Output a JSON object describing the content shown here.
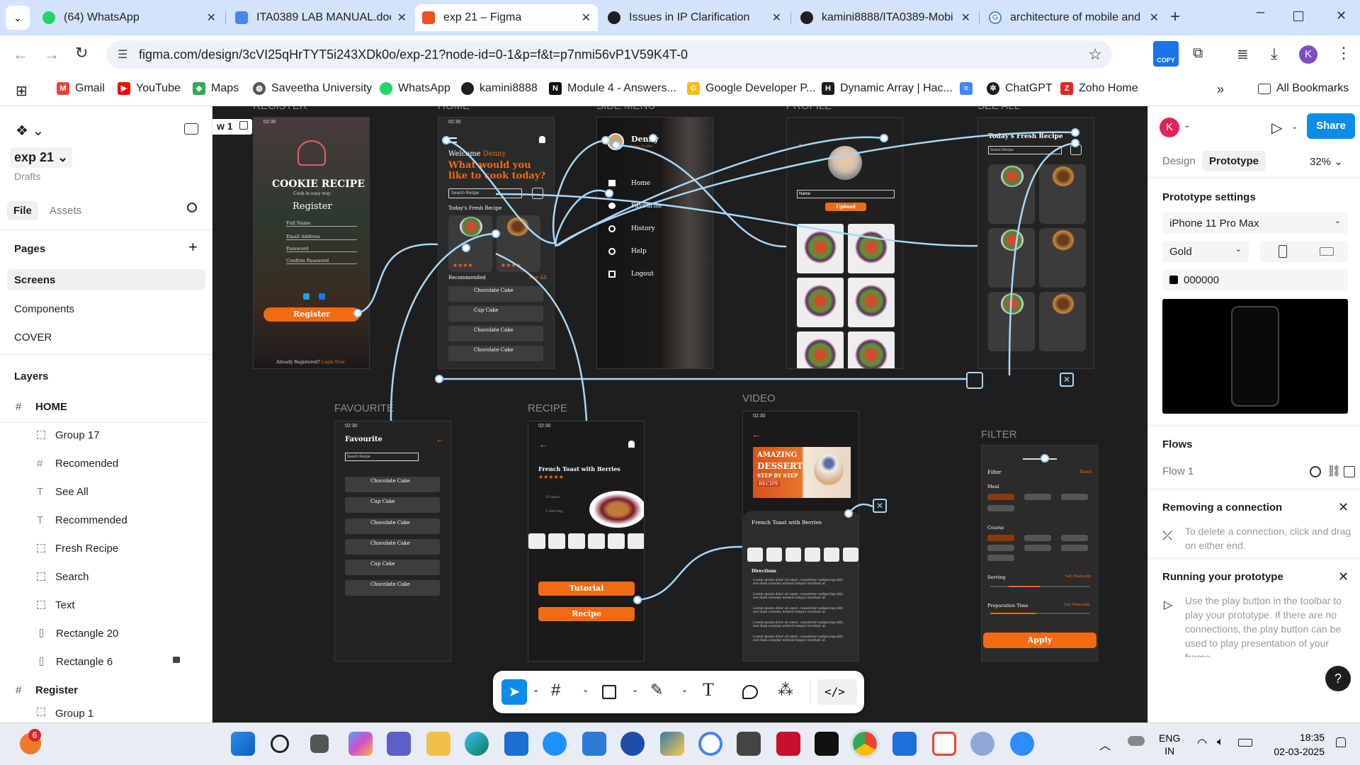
{
  "browser": {
    "tabs": [
      {
        "title": "(64) WhatsApp",
        "icon": "whatsapp-icon",
        "color": "#25d366"
      },
      {
        "title": "ITA0389 LAB MANUAL.doc",
        "icon": "docs-icon",
        "color": "#4285f4"
      },
      {
        "title": "exp 21 – Figma",
        "icon": "figma-icon",
        "color": "#f24e1e",
        "active": true
      },
      {
        "title": "Issues in IP Clarification",
        "icon": "chatgpt-icon",
        "color": "#1f1f1f"
      },
      {
        "title": "kamini8888/ITA0389-Mobi",
        "icon": "github-icon",
        "color": "#1f1f1f"
      },
      {
        "title": "architecture of mobile and",
        "icon": "google-icon",
        "color": "#4285f4"
      }
    ],
    "url": "figma.com/design/3cVI25qHrTYT5i243XDk0o/exp-21?node-id=0-1&p=f&t=p7nmi56vP1V59K4T-0",
    "profile_initial": "K",
    "copy_badge": "COPY",
    "bookmarks": [
      {
        "label": "Gmail",
        "color": "#ea4335"
      },
      {
        "label": "YouTube",
        "color": "#ff0000"
      },
      {
        "label": "Maps",
        "color": "#34a853"
      },
      {
        "label": "Saveetha University",
        "color": "#555555"
      },
      {
        "label": "WhatsApp",
        "color": "#25d366"
      },
      {
        "label": "kamini8888",
        "color": "#1f1f1f"
      },
      {
        "label": "Module 4 - Answers...",
        "color": "#111111"
      },
      {
        "label": "Google Developer P...",
        "color": "#fbbc05"
      },
      {
        "label": "Dynamic Array | Hac...",
        "color": "#1b1b1b"
      },
      {
        "label": "",
        "color": "#4285f4"
      },
      {
        "label": "ChatGPT",
        "color": "#1f1f1f"
      },
      {
        "label": "Zoho Home",
        "color": "#e42527"
      }
    ],
    "all_bookmarks": "All Bookmarks"
  },
  "figma": {
    "file_name": "exp 21",
    "file_location": "Drafts",
    "left_tabs": [
      "File",
      "Assets"
    ],
    "pages_heading": "Pages",
    "pages": [
      "Screens",
      "Components",
      "COVER"
    ],
    "layers_heading": "Layers",
    "layers": [
      {
        "name": "HOME",
        "kind": "frame",
        "level": 0
      },
      {
        "name": "Group 17",
        "kind": "group",
        "level": 1
      },
      {
        "name": "Recomended",
        "kind": "frame",
        "level": 1
      },
      {
        "name": "See All",
        "kind": "text",
        "level": 1
      },
      {
        "name": "Recommended",
        "kind": "text",
        "level": 1
      },
      {
        "name": "Fresh Recipe",
        "kind": "group",
        "level": 1
      },
      {
        "name": "Search",
        "kind": "group",
        "level": 1
      },
      {
        "name": "Text",
        "kind": "group",
        "level": 1
      },
      {
        "name": "Rectangle 20",
        "kind": "rect",
        "level": 1
      },
      {
        "name": "Rectangle 6",
        "kind": "rect",
        "level": 1,
        "locked": true
      },
      {
        "name": "Register",
        "kind": "frame",
        "level": 0
      },
      {
        "name": "Group 1",
        "kind": "group",
        "level": 1
      }
    ],
    "right": {
      "avatar": "K",
      "share": "Share",
      "tabs": [
        "Design",
        "Prototype"
      ],
      "zoom": "32%",
      "prototype_settings": "Prototype settings",
      "device": "iPhone 11 Pro Max",
      "device_color": "Gold",
      "bg_hex": "000000",
      "flows_heading": "Flows",
      "flow_name": "Flow 1",
      "tip1_title": "Removing a connection",
      "tip1_body": "To delete a connection, click and drag on either end.",
      "tip2_title": "Running your prototype",
      "tip2_body": "Use the play button in the toolbar to play your prototype. If there are no connections, the play button can be used to play presentation of your frame"
    },
    "canvas": {
      "frame_labels": [
        "REGISTER",
        "HOME",
        "SIDE MENU",
        "PROFILE",
        "SEE ALL",
        "FAVOURITE",
        "RECIPE",
        "VIDEO",
        "FILTER"
      ],
      "flow_tag": "w 1",
      "register": {
        "status_time": "02:30",
        "brand": "COOKIE RECIPE",
        "tagline": "Cook in easy way",
        "heading": "Register",
        "fields": [
          "Full Name",
          "Email Address",
          "Password",
          "Confirm Password"
        ],
        "button": "Register",
        "footer_q": "Already Registered?",
        "footer_link": "Login Now"
      },
      "home": {
        "status_time": "02:30",
        "welcome": "Welcome",
        "user": "Denny",
        "question": "What would you like to cook today?",
        "search": "Search Recipe",
        "fresh": "Today's Fresh Recipe",
        "see_all": "See All",
        "recommended": "Recommended",
        "items": [
          "Chocolate Cake",
          "Cup Cake",
          "Chocolate Cake",
          "Chocolate Cake"
        ]
      },
      "side_menu": {
        "user": "Denny",
        "sub": "View Profile",
        "items": [
          "Home",
          "Favourite",
          "History",
          "Help",
          "Logout"
        ]
      },
      "profile": {
        "name_label": "Name",
        "upload": "Upload"
      },
      "see_all": {
        "title": "Today's Fresh Recipe",
        "search": "Search Recipe"
      },
      "favourite": {
        "status_time": "02:30",
        "title": "Favourite",
        "search": "Search Recipe",
        "items": [
          "Chocolate Cake",
          "Cup Cake",
          "Chocolate Cake",
          "Chocolate Cake",
          "Cup Cake",
          "Chocolate Cake"
        ]
      },
      "recipe": {
        "status_time": "02:30",
        "title": "French Toast with Berries",
        "time": "10 mins",
        "serving": "1 Serving",
        "tutorial": "Tutorial",
        "recipe": "Recipe"
      },
      "video": {
        "status_time": "02:30",
        "banner1": "AMAZING",
        "banner2": "DESSERT",
        "banner3": "STEP BY STEP",
        "banner4": "RECIPE",
        "title": "French Toast with Berries",
        "directions": "Directions",
        "lorem": "Lorem ipsum dolor sit amet, consetetur sadipscing elitr, sed diam nonumy eirmod tempor invidunt ut."
      },
      "filter": {
        "title": "Filter",
        "reset": "Reset",
        "meal": "Meal",
        "meal_opts": [
          "Breakfast",
          "Brunch",
          "Lunch",
          "Dinner"
        ],
        "course": "Course",
        "course_opts": [
          "Soup",
          "Appetizer",
          "Starter",
          "Main Dish",
          "Side",
          "Dessert",
          "Drinks"
        ],
        "serving": "Serving",
        "set_manually": "Set Manually",
        "prep": "Preparation Time",
        "apply": "Apply"
      }
    }
  },
  "taskbar": {
    "lang1": "ENG",
    "lang2": "IN",
    "time": "18:35",
    "date": "02-03-2025",
    "notif_count": "6"
  }
}
